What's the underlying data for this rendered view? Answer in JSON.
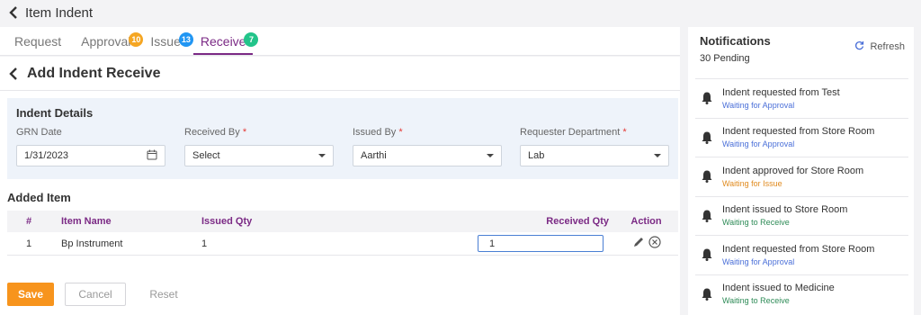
{
  "header": {
    "title": "Item Indent"
  },
  "tabs": [
    {
      "label": "Request",
      "badge": ""
    },
    {
      "label": "Approval",
      "badge": "10",
      "badge_color": "#f5a623"
    },
    {
      "label": "Issue",
      "badge": "13",
      "badge_color": "#2196f3"
    },
    {
      "label": "Receive",
      "badge": "7",
      "badge_color": "#22c48a"
    }
  ],
  "form": {
    "title": "Add Indent Receive",
    "details_heading": "Indent Details",
    "grn_date": {
      "label": "GRN Date",
      "value": "1/31/2023"
    },
    "received_by": {
      "label": "Received By",
      "required": "*",
      "value": "Select"
    },
    "issued_by": {
      "label": "Issued By",
      "required": "*",
      "value": "Aarthi"
    },
    "requester_department": {
      "label": "Requester Department",
      "required": "*",
      "value": "Lab"
    }
  },
  "added_items": {
    "heading": "Added Item",
    "columns": [
      "#",
      "Item Name",
      "Issued Qty",
      "Received Qty",
      "Action"
    ],
    "rows": [
      {
        "index": "1",
        "item_name": "Bp Instrument",
        "issued_qty": "1",
        "received_qty": "1"
      }
    ]
  },
  "buttons": {
    "save": "Save",
    "cancel": "Cancel",
    "reset": "Reset"
  },
  "notifications": {
    "title": "Notifications",
    "pending": "30 Pending",
    "refresh": "Refresh",
    "items": [
      {
        "title": "Indent requested from Test",
        "status": "Waiting for Approval",
        "status_color": "#4a6fd8"
      },
      {
        "title": "Indent requested from Store Room",
        "status": "Waiting for Approval",
        "status_color": "#4a6fd8"
      },
      {
        "title": "Indent approved for Store Room",
        "status": "Waiting for Issue",
        "status_color": "#e08a1e"
      },
      {
        "title": "Indent issued to Store Room",
        "status": "Waiting to Receive",
        "status_color": "#2e8b57"
      },
      {
        "title": "Indent requested from Store Room",
        "status": "Waiting for Approval",
        "status_color": "#4a6fd8"
      },
      {
        "title": "Indent issued to Medicine",
        "status": "Waiting to Receive",
        "status_color": "#2e8b57"
      }
    ]
  },
  "colors": {
    "accent": "#7b2a85",
    "save": "#f7941d"
  }
}
